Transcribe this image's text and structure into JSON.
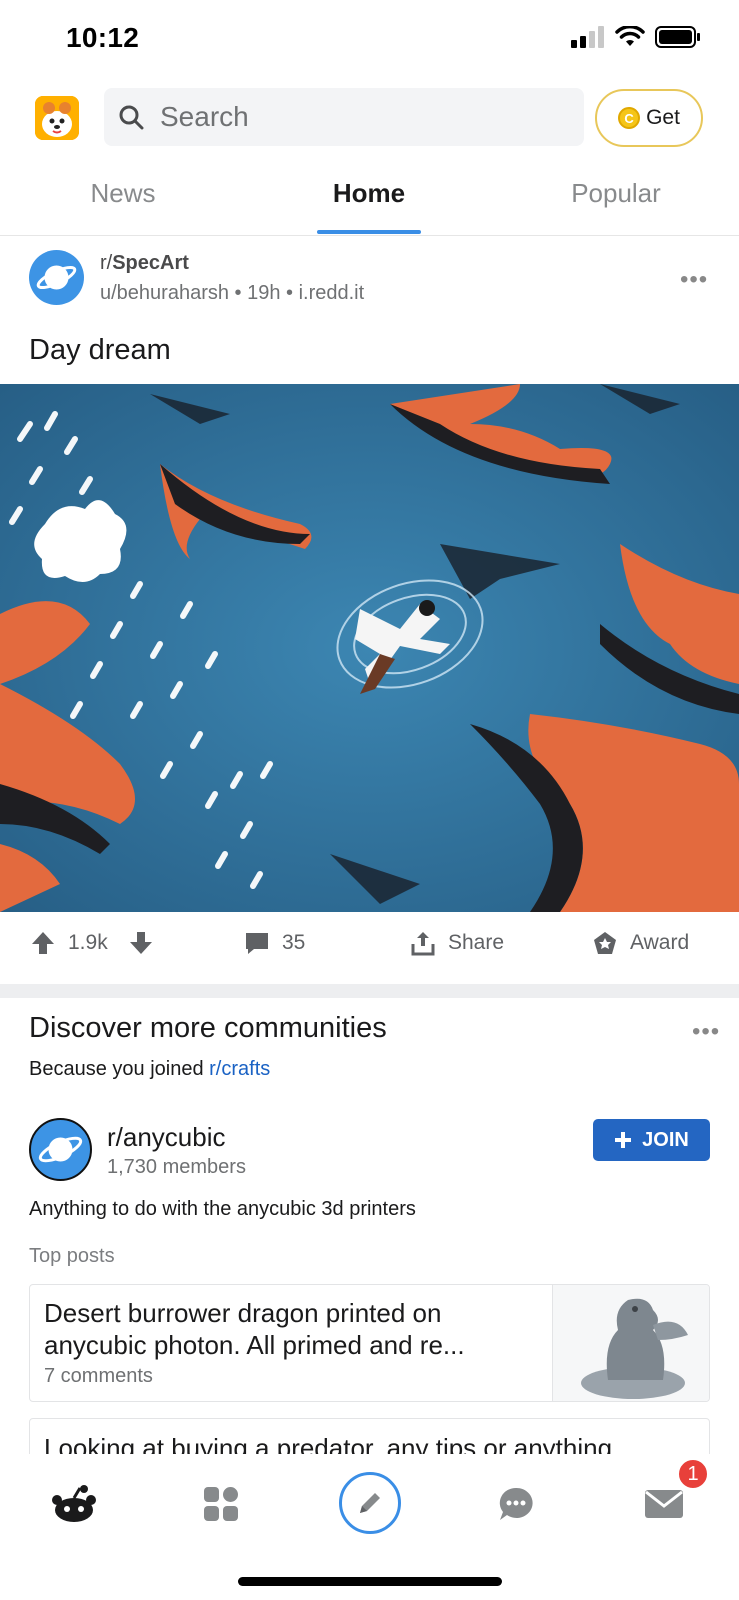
{
  "status_bar": {
    "time": "10:12"
  },
  "header": {
    "search_placeholder": "Search",
    "get_label": "Get",
    "coin_glyph": "C"
  },
  "tabs": [
    {
      "label": "News"
    },
    {
      "label": "Home"
    },
    {
      "label": "Popular"
    }
  ],
  "post": {
    "subreddit_prefix": "r/",
    "subreddit": "SpecArt",
    "meta": "u/behuraharsh • 19h • i.redd.it",
    "title": "Day dream",
    "more": "•••",
    "upvotes": "1.9k",
    "comments": "35",
    "share_label": "Share",
    "award_label": "Award"
  },
  "discover": {
    "title": "Discover more communities",
    "more": "•••",
    "because_prefix": "Because you joined",
    "because_link": "r/crafts",
    "community": {
      "name": "r/anycubic",
      "members": "1,730 members",
      "join_label": "JOIN",
      "description": "Anything to do with the anycubic 3d printers"
    },
    "top_posts_label": "Top posts",
    "top_posts": [
      {
        "title": "Desert burrower dragon printed on anycubic photon. All primed and re...",
        "comments": "7 comments"
      },
      {
        "title": "Looking at buying a predator, any tips or anything"
      }
    ]
  },
  "bottom_nav": {
    "inbox_badge": "1"
  },
  "colors": {
    "accent": "#3a8ee6",
    "join": "#2466c2",
    "badge": "#e8403a",
    "avatar": "#3d94e5"
  }
}
